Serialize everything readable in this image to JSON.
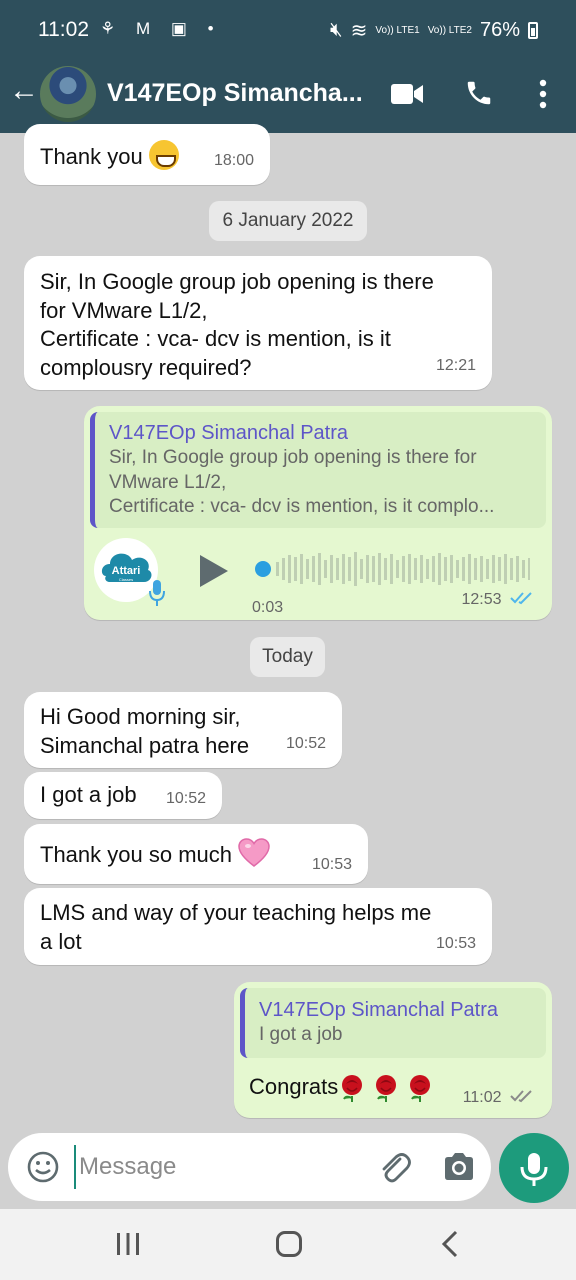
{
  "status_bar": {
    "time": "11:02",
    "left_icons": "⚘ M ▣ •",
    "sim1": "Vo)) LTE1",
    "sim2": "Vo)) LTE2",
    "battery": "76%"
  },
  "header": {
    "contact_name": "V147EOp Simancha...",
    "icons": [
      "back-arrow-icon",
      "video-call-icon",
      "phone-icon",
      "more-vert-icon"
    ]
  },
  "messages": [
    {
      "type": "incoming",
      "text": "Thank you",
      "emoji": "grinning-face",
      "time": "18:00"
    },
    {
      "type": "date",
      "text": "6 January 2022"
    },
    {
      "type": "incoming",
      "lines": [
        "Sir, In Google group job opening is there",
        "for VMware L1/2,",
        "Certificate : vca- dcv is mention, is it",
        "complousry required?"
      ],
      "time": "12:21"
    },
    {
      "type": "outgoing-voice",
      "quote_name": "V147EOp Simanchal Patra",
      "quote_lines": [
        "Sir, In Google group job opening is there for",
        "VMware L1/2,",
        "Certificate : vca- dcv is mention, is it complo..."
      ],
      "avatar_label": "Attari",
      "avatar_sub": "Classes",
      "duration": "0:03",
      "time": "12:53",
      "status": "read"
    },
    {
      "type": "date",
      "text": "Today"
    },
    {
      "type": "incoming",
      "lines": [
        "Hi Good morning sir,",
        "Simanchal patra here"
      ],
      "time": "10:52"
    },
    {
      "type": "incoming",
      "text": "I got a job",
      "time": "10:52"
    },
    {
      "type": "incoming",
      "text": "Thank you so much",
      "emoji": "pink-heart",
      "time": "10:53"
    },
    {
      "type": "incoming",
      "lines": [
        "LMS and way of your teaching  helps me",
        "a lot"
      ],
      "time": "10:53"
    },
    {
      "type": "outgoing-reply",
      "quote_name": "V147EOp Simanchal Patra",
      "quote_text": "I got a job",
      "text": "Congrats",
      "emoji": "rose x3",
      "time": "11:02",
      "status": "delivered"
    }
  ],
  "input": {
    "placeholder": "Message",
    "icons": [
      "emoji-icon",
      "attach-icon",
      "camera-icon",
      "mic-icon"
    ]
  },
  "nav": [
    "recent-apps-icon",
    "home-icon",
    "back-icon"
  ],
  "colors": {
    "header": "#2e4f5c",
    "chat_bg": "#d1d1d1",
    "incoming": "#ffffff",
    "outgoing": "#e5f8d0",
    "quote_accent": "#5d55c8",
    "read_ticks": "#4fb6ec",
    "fab": "#1d9b7c"
  }
}
